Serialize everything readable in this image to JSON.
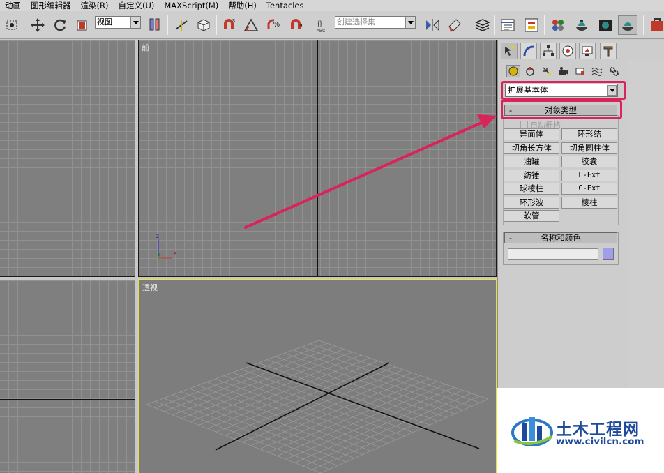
{
  "menu": [
    "动画",
    "图形编辑器",
    "渲染(R)",
    "自定义(U)",
    "MAXScript(M)",
    "帮助(H)",
    "Tentacles"
  ],
  "toolbar": {
    "view_combo": "视图",
    "selection_set_placeholder": "创建选择集",
    "icons": [
      "select-region-icon",
      "move-icon",
      "rotate-icon",
      "scale-icon",
      "reference-coord-icon",
      "pivot-icon",
      "manipulate-icon",
      "snap-3d-icon",
      "angle-snap-icon",
      "percent-snap-icon",
      "spinner-snap-icon",
      "named-selection-icon",
      "mirror-icon",
      "align-icon",
      "layer-manager-icon",
      "curve-editor-icon",
      "schematic-view-icon",
      "material-editor-icon",
      "render-setup-icon",
      "render-frame-icon",
      "quick-render-icon",
      "toolbox-icon"
    ],
    "selset_icon_label": "ABC"
  },
  "viewports": {
    "front_label": "前",
    "perspective_label": "透视",
    "axis_labels": {
      "z": "z",
      "y": "y",
      "x": "x"
    }
  },
  "command_panel": {
    "tabs": [
      "create-tab-icon",
      "modify-tab-icon",
      "hierarchy-tab-icon",
      "motion-tab-icon",
      "display-tab-icon",
      "utilities-tab-icon"
    ],
    "categories": [
      "geometry-icon",
      "shapes-icon",
      "lights-icon",
      "cameras-icon",
      "helpers-icon",
      "space-warps-icon",
      "systems-icon"
    ],
    "type_dropdown": "扩展基本体",
    "object_type_title": "对象类型",
    "rollup_minus": "-",
    "auto_grid": "自动栅格",
    "object_buttons": [
      "异面体",
      "环形结",
      "切角长方体",
      "切角圆柱体",
      "油罐",
      "胶囊",
      "纺锤",
      "L-Ext",
      "球棱柱",
      "C-Ext",
      "环形波",
      "棱柱",
      "软管"
    ],
    "name_color_title": "名称和颜色",
    "name_value": "",
    "object_color": "#9f9ee8"
  },
  "annotation": {
    "highlight_color": "#d8245a"
  },
  "watermark": {
    "title": "土木工程网",
    "url": "www.civilcn.com",
    "brand_color": "#1d4a9a"
  }
}
